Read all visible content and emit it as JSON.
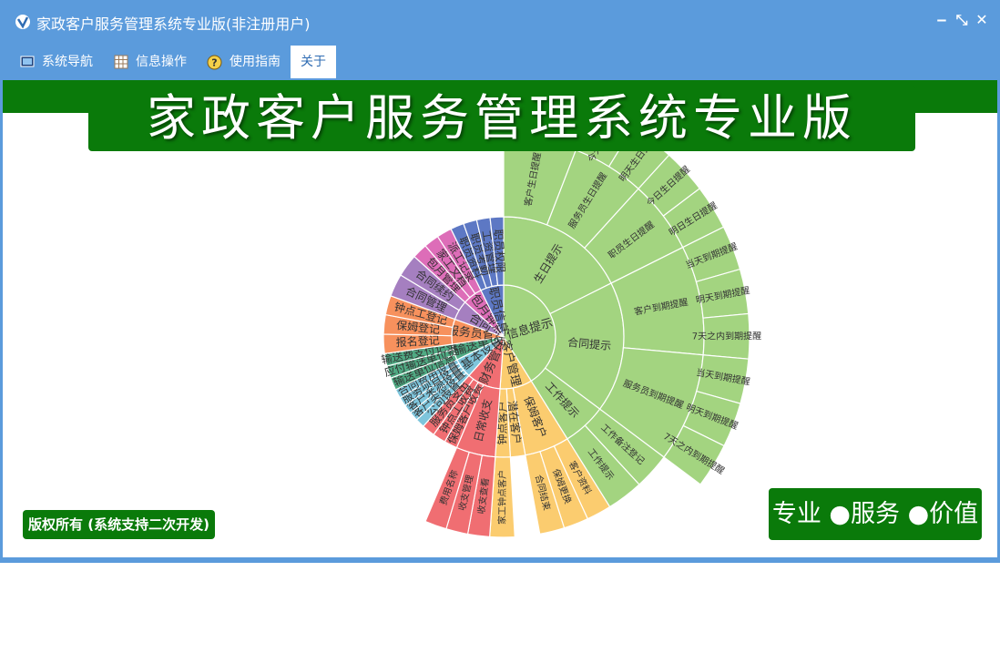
{
  "window": {
    "title": "家政客户服务管理系统专业版(非注册用户)",
    "controls": [
      "‒",
      "⤡",
      "✕"
    ]
  },
  "menu": {
    "items": [
      {
        "label": "系统导航",
        "icon": "monitor-icon"
      },
      {
        "label": "信息操作",
        "icon": "grid-icon"
      },
      {
        "label": "使用指南",
        "icon": "help-icon"
      },
      {
        "label": "关于",
        "icon": ""
      }
    ]
  },
  "banner": {
    "title": "家政客户服务管理系统专业版"
  },
  "footer": {
    "copyright": "版权所有 (系统支持二次开发)",
    "slogan": "专业 ●服务 ●价值"
  },
  "colors": {
    "green": "#a3d480",
    "yellow": "#fbcc6f",
    "red": "#f06e72",
    "blue": "#7ec5dc",
    "teal": "#4faa83",
    "orange": "#f7915d",
    "purple": "#a57fc0",
    "pink": "#dd6db8",
    "indigo": "#5d78c4",
    "banner": "#0a7a0a",
    "window": "#5b9bdc"
  },
  "chart_data": {
    "type": "sunburst",
    "root": [
      {
        "label": "信息提示",
        "color": "green",
        "children": [
          {
            "label": "生日提示",
            "children": [
              {
                "label": "客户生日提醒",
                "children": [
                  {
                    "label": "今天生日提醒"
                  },
                  {
                    "label": "明日生日提醒"
                  }
                ]
              },
              {
                "label": "服务员生日提醒",
                "children": [
                  {
                    "label": "今天生日提醒"
                  },
                  {
                    "label": "明天生日提醒"
                  }
                ]
              },
              {
                "label": "职员生日提醒",
                "children": [
                  {
                    "label": "今日生日提醒"
                  },
                  {
                    "label": "明日生日提醒"
                  }
                ]
              }
            ]
          },
          {
            "label": "合同提示",
            "children": [
              {
                "label": "客户到期提醒",
                "children": [
                  {
                    "label": "当天到期提醒"
                  },
                  {
                    "label": "明天到期提醒"
                  },
                  {
                    "label": "7天之内到期提醒"
                  }
                ]
              },
              {
                "label": "服务员到期提醒",
                "children": [
                  {
                    "label": "当天到期提醒"
                  },
                  {
                    "label": "明天到期提醒"
                  },
                  {
                    "label": "7天之内到期提醒"
                  }
                ]
              }
            ]
          },
          {
            "label": "工作提示",
            "children": [
              {
                "label": "工作备注登记"
              },
              {
                "label": "工作提示"
              }
            ]
          }
        ]
      },
      {
        "label": "客户管理",
        "color": "yellow",
        "children": [
          {
            "label": "保姆客户",
            "children": [
              {
                "label": "客户资料"
              },
              {
                "label": "保姆更换"
              },
              {
                "label": "合同结束"
              }
            ]
          },
          {
            "label": "潜在客户",
            "children": []
          },
          {
            "label": "钟点客户",
            "children": [
              {
                "label": "家工钟点客户"
              }
            ]
          }
        ]
      },
      {
        "label": "财务管理",
        "color": "red",
        "children": [
          {
            "label": "日常收支",
            "children": [
              {
                "label": "收支查看"
              },
              {
                "label": "收支管理"
              },
              {
                "label": "费用名称"
              }
            ]
          },
          {
            "label": "保姆客户收费",
            "children": []
          },
          {
            "label": "钟点工收费",
            "children": []
          },
          {
            "label": "服务员支出",
            "children": []
          }
        ]
      },
      {
        "label": "基本设置",
        "color": "blue",
        "children": [
          {
            "label": "公司设置"
          },
          {
            "label": "客户类型设置"
          },
          {
            "label": "客户来源设置"
          },
          {
            "label": "服务项目设置"
          },
          {
            "label": "合同费用设置"
          }
        ]
      },
      {
        "label": "输送单位",
        "color": "teal",
        "children": [
          {
            "label": "输送单位信息"
          },
          {
            "label": "应付输送单位费"
          },
          {
            "label": "输送费支付记录"
          }
        ]
      },
      {
        "label": "服务员管理",
        "color": "orange",
        "children": [
          {
            "label": "报名登记"
          },
          {
            "label": "保姆登记"
          },
          {
            "label": "钟点工登记"
          }
        ]
      },
      {
        "label": "合同",
        "color": "purple",
        "children": [
          {
            "label": "合同管理"
          },
          {
            "label": "合同续约"
          }
        ]
      },
      {
        "label": "包月钟点",
        "color": "pink",
        "children": [
          {
            "label": "包月管理"
          },
          {
            "label": "家工文档"
          },
          {
            "label": "派工记录"
          }
        ]
      },
      {
        "label": "职员信息",
        "color": "indigo",
        "children": [
          {
            "label": "职员资料"
          },
          {
            "label": "职员考勤"
          },
          {
            "label": "工资管理"
          },
          {
            "label": "职员权限"
          }
        ]
      }
    ]
  }
}
